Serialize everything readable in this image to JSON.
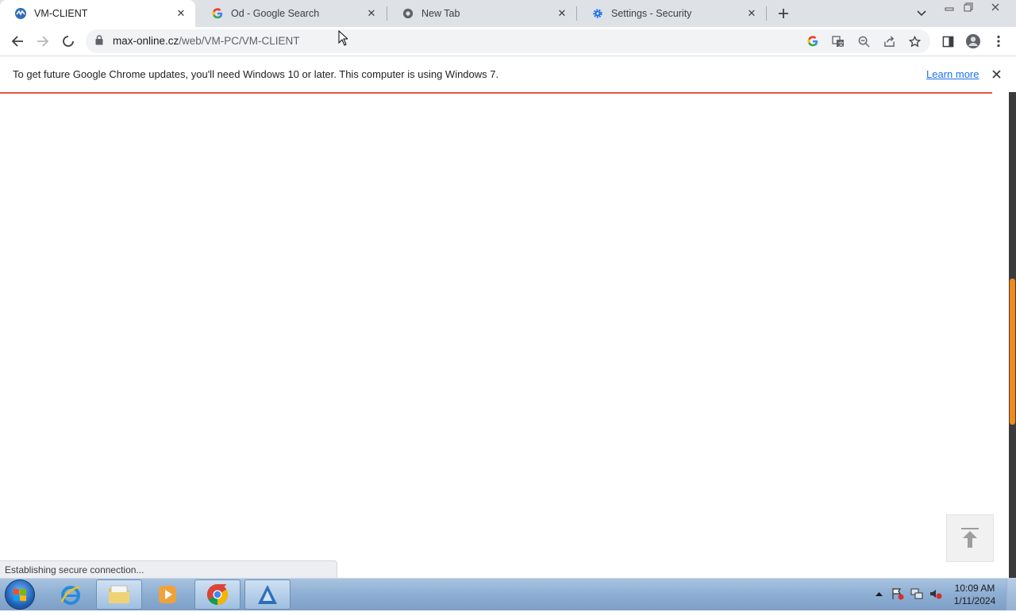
{
  "browser": {
    "tabs": [
      {
        "title": "VM-CLIENT",
        "icon": "vm-client-favicon",
        "active": true
      },
      {
        "title": "Od - Google Search",
        "icon": "google-favicon",
        "active": false
      },
      {
        "title": "New Tab",
        "icon": "chrome-favicon",
        "active": false
      },
      {
        "title": "Settings - Security",
        "icon": "gear-icon",
        "active": false
      }
    ],
    "url": {
      "host": "max-online.cz",
      "path": "/web/VM-PC/VM-CLIENT"
    },
    "infobar": {
      "message": "To get future Google Chrome updates, you'll need Windows 10 or later. This computer is using Windows 7.",
      "link": "Learn more"
    },
    "status_text": "Establishing secure connection...",
    "accent_color": "#e8593c",
    "scroll_position": 0.55
  },
  "taskbar": {
    "apps": [
      "start-orb",
      "internet-explorer-icon",
      "file-explorer-icon",
      "media-player-icon",
      "chrome-icon",
      "vm-client-app-icon"
    ],
    "clock": {
      "time": "10:09 AM",
      "date": "1/11/2024"
    }
  }
}
